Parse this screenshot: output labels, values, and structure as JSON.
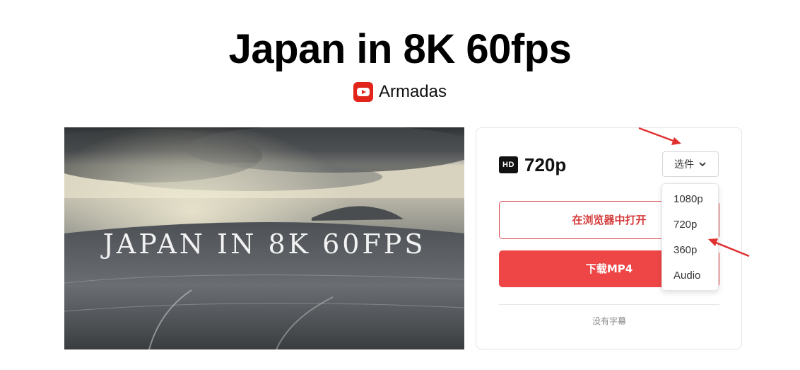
{
  "video": {
    "title": "Japan in 8K 60fps",
    "channel_icon": "youtube-icon",
    "channel_name": "Armadas",
    "thumbnail_text": "JAPAN IN 8K 60FPS"
  },
  "panel": {
    "hd_badge": "HD",
    "quality": "720p",
    "select_label": "选件",
    "open_in_browser": "在浏览器中打开",
    "download": "下载MP4",
    "subtitles_note": "没有字幕"
  },
  "dropdown": {
    "options": [
      "1080p",
      "720p",
      "360p",
      "Audio"
    ]
  },
  "colors": {
    "accent_red": "#ee4646",
    "youtube_red": "#e1251b",
    "annotation_arrow": "#e03030"
  }
}
